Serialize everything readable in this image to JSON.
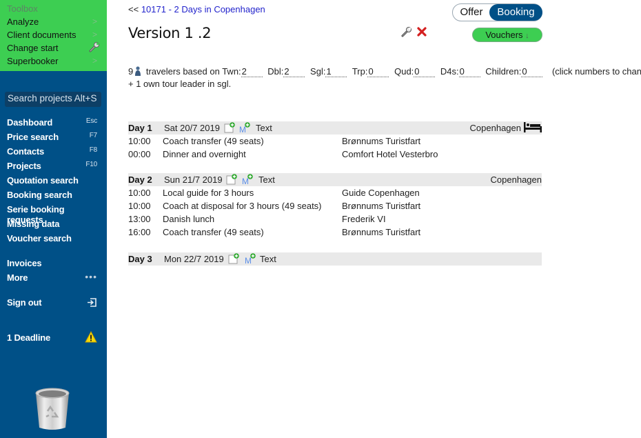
{
  "sidebar": {
    "toolbox": {
      "title": "Toolbox",
      "items": [
        {
          "label": "Analyze",
          "icon": "chevron-right-icon",
          "glyph": ">"
        },
        {
          "label": "Client documents",
          "icon": "chevron-right-icon",
          "glyph": ">"
        },
        {
          "label": "Change start",
          "icon": "wrench-icon",
          "glyph": ""
        },
        {
          "label": "Superbooker",
          "icon": "chevron-right-icon",
          "glyph": ">"
        }
      ]
    },
    "search_placeholder": "Search projects Alt+S",
    "nav": [
      {
        "label": "Dashboard",
        "shortcut": "Esc"
      },
      {
        "label": "Price search",
        "shortcut": "F7"
      },
      {
        "label": "Contacts",
        "shortcut": "F8"
      },
      {
        "label": "Projects",
        "shortcut": "F10"
      },
      {
        "label": "Quotation search",
        "shortcut": ""
      },
      {
        "label": "Booking search",
        "shortcut": ""
      },
      {
        "label": "Serie booking requests",
        "shortcut": ""
      },
      {
        "label": "Missing data",
        "shortcut": ""
      },
      {
        "label": "Voucher search",
        "shortcut": ""
      }
    ],
    "invoices": "Invoices",
    "more": "More",
    "more_glyph": "•••",
    "sign_out": "Sign out",
    "deadline": "1 Deadline",
    "colors": {
      "sidebar": "#005087",
      "toolbox": "#3dce52"
    }
  },
  "header": {
    "back_prefix": "<<",
    "back_link": "10171 - 2 Days in Copenhagen",
    "title": "Version 1 .2",
    "toggle": {
      "offer": "Offer",
      "booking": "Booking",
      "selected": "Booking"
    },
    "vouchers_label": "Vouchers",
    "vouchers_arrow": "↓"
  },
  "travelers": {
    "count": "9",
    "text": "travelers based on",
    "fields": [
      {
        "label": "Twn:",
        "value": "2"
      },
      {
        "label": "Dbl:",
        "value": "2"
      },
      {
        "label": "Sgl:",
        "value": "1"
      },
      {
        "label": "Trp:",
        "value": "0"
      },
      {
        "label": "Qud:",
        "value": "0"
      },
      {
        "label": "D4s:",
        "value": "0"
      },
      {
        "label": "Children:",
        "value": "0"
      }
    ],
    "hint": "(click numbers to change)",
    "tour_leader": "+ 1 own tour leader in sgl."
  },
  "days": [
    {
      "label": "Day 1",
      "date": "Sat 20/7 2019",
      "text_link": "Text",
      "m_label": "M",
      "city": "Copenhagen",
      "has_bed": true,
      "rows": [
        {
          "time": "10:00",
          "desc": "Coach transfer (49 seats)",
          "supplier": "Brønnums Turistfart"
        },
        {
          "time": "00:00",
          "desc": "Dinner and overnight",
          "supplier": "Comfort Hotel Vesterbro"
        }
      ]
    },
    {
      "label": "Day 2",
      "date": "Sun 21/7 2019",
      "text_link": "Text",
      "m_label": "M",
      "city": "Copenhagen",
      "has_bed": false,
      "rows": [
        {
          "time": "10:00",
          "desc": "Local guide for 3 hours",
          "supplier": "Guide Copenhagen"
        },
        {
          "time": "10:00",
          "desc": "Coach at disposal for 3 hours (49 seats)",
          "supplier": "Brønnums Turistfart"
        },
        {
          "time": "13:00",
          "desc": "Danish lunch",
          "supplier": "Frederik VI"
        },
        {
          "time": "16:00",
          "desc": "Coach transfer (49 seats)",
          "supplier": "Brønnums Turistfart"
        }
      ]
    },
    {
      "label": "Day 3",
      "date": "Mon 22/7 2019",
      "text_link": "Text",
      "m_label": "M",
      "city": "",
      "has_bed": false,
      "rows": []
    }
  ]
}
